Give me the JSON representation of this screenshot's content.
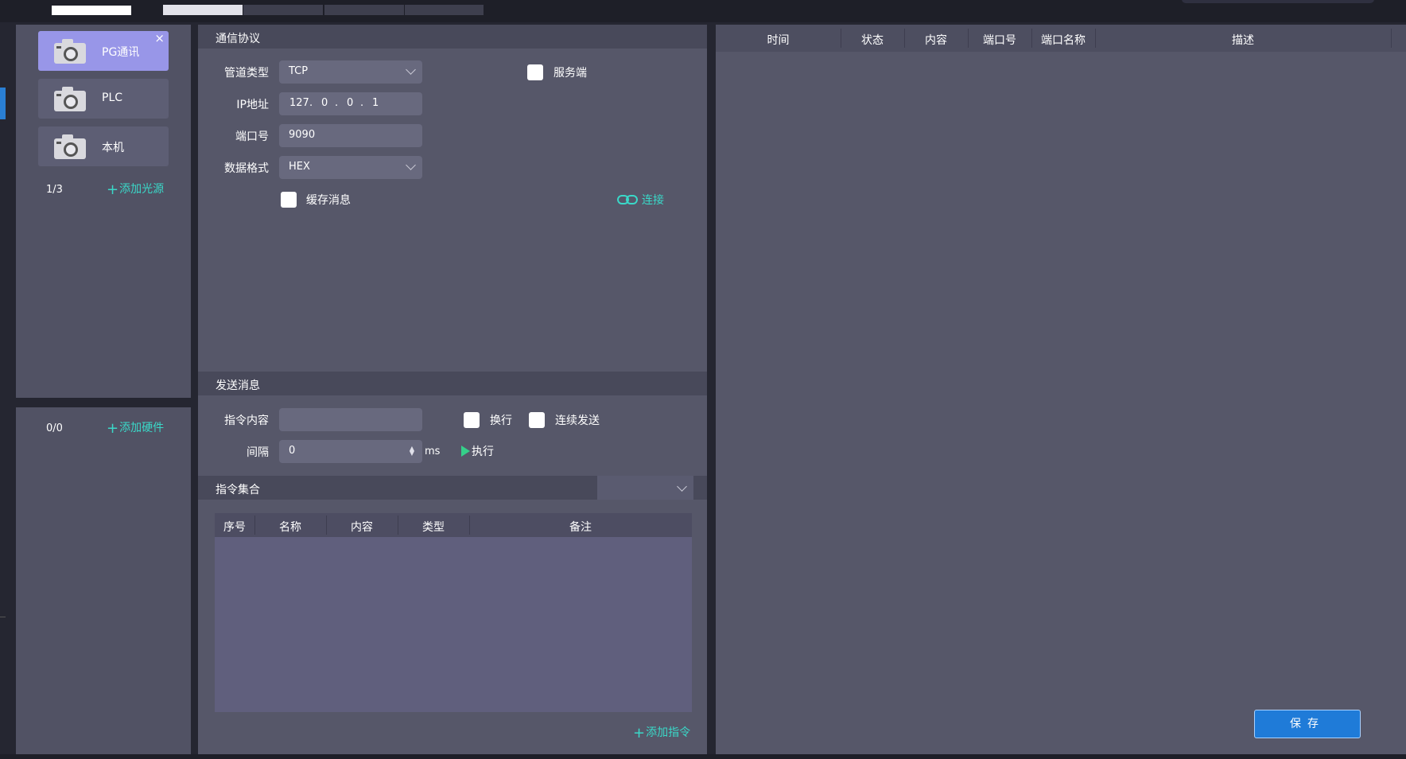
{
  "devices": {
    "items": [
      {
        "label": "PG通讯",
        "active": true
      },
      {
        "label": "PLC",
        "active": false
      },
      {
        "label": "本机",
        "active": false
      }
    ],
    "close_symbol": "×",
    "count": "1/3",
    "add_label": "添加光源"
  },
  "hardware": {
    "count": "0/0",
    "add_label": "添加硬件"
  },
  "protocol": {
    "title": "通信协议",
    "pipe_type_label": "管道类型",
    "pipe_type_value": "TCP",
    "server_label": "服务端",
    "ip_label": "IP地址",
    "ip": [
      "127",
      "0",
      "0",
      "1"
    ],
    "ip_dot": ".",
    "port_label": "端口号",
    "port_value": "9090",
    "format_label": "数据格式",
    "format_value": "HEX",
    "cache_label": "缓存消息",
    "connect_label": "连接"
  },
  "send": {
    "title": "发送消息",
    "command_label": "指令内容",
    "command_value": "",
    "newline_label": "换行",
    "continuous_label": "连续发送",
    "interval_label": "间隔",
    "interval_value": "0",
    "interval_unit": "ms",
    "execute_label": "执行"
  },
  "command_set": {
    "title": "指令集合",
    "select_value": "",
    "columns": [
      "序号",
      "名称",
      "内容",
      "类型",
      "备注"
    ],
    "rows": [],
    "add_label": "添加指令"
  },
  "log": {
    "columns": [
      "时间",
      "状态",
      "内容",
      "端口号",
      "端口名称",
      "描述"
    ],
    "rows": []
  },
  "save_label": "保存",
  "colors": {
    "accent": "#3ad8c8",
    "active_card": "#9896e8",
    "save_button": "#1f7bd8",
    "play": "#35d08a"
  }
}
